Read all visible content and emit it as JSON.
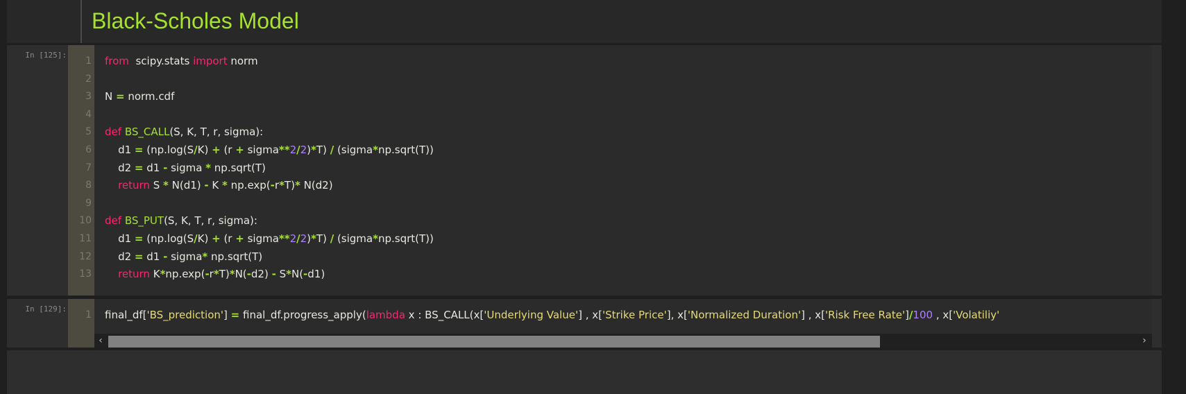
{
  "markdown": {
    "title": "Black-Scholes Model"
  },
  "cells": [
    {
      "prompt": "In [125]:",
      "lines": [
        {
          "n": "1",
          "tokens": [
            [
              "kw",
              "from"
            ],
            [
              "",
              "  scipy.stats "
            ],
            [
              "kw",
              "import"
            ],
            [
              "",
              " norm"
            ]
          ]
        },
        {
          "n": "2",
          "tokens": []
        },
        {
          "n": "3",
          "tokens": [
            [
              "",
              "N "
            ],
            [
              "op",
              "="
            ],
            [
              "",
              " norm.cdf"
            ]
          ]
        },
        {
          "n": "4",
          "tokens": []
        },
        {
          "n": "5",
          "tokens": [
            [
              "kw",
              "def"
            ],
            [
              "",
              " "
            ],
            [
              "fn",
              "BS_CALL"
            ],
            [
              "",
              "(S, K, T, r, sigma):"
            ]
          ]
        },
        {
          "n": "6",
          "tokens": [
            [
              "",
              "    d1 "
            ],
            [
              "op",
              "="
            ],
            [
              "",
              " (np.log(S"
            ],
            [
              "op",
              "/"
            ],
            [
              "",
              "K) "
            ],
            [
              "op",
              "+"
            ],
            [
              "",
              " (r "
            ],
            [
              "op",
              "+"
            ],
            [
              "",
              " sigma"
            ],
            [
              "op",
              "**"
            ],
            [
              "num",
              "2"
            ],
            [
              "op",
              "/"
            ],
            [
              "num",
              "2"
            ],
            [
              "",
              ")"
            ],
            [
              "op",
              "*"
            ],
            [
              "",
              "T) "
            ],
            [
              "op",
              "/"
            ],
            [
              "",
              " (sigma"
            ],
            [
              "op",
              "*"
            ],
            [
              "",
              "np.sqrt(T))"
            ]
          ]
        },
        {
          "n": "7",
          "tokens": [
            [
              "",
              "    d2 "
            ],
            [
              "op",
              "="
            ],
            [
              "",
              " d1 "
            ],
            [
              "op",
              "-"
            ],
            [
              "",
              " sigma "
            ],
            [
              "op",
              "*"
            ],
            [
              "",
              " np.sqrt(T)"
            ]
          ]
        },
        {
          "n": "8",
          "tokens": [
            [
              "",
              "    "
            ],
            [
              "kw",
              "return"
            ],
            [
              "",
              " S "
            ],
            [
              "op",
              "*"
            ],
            [
              "",
              " N(d1) "
            ],
            [
              "op",
              "-"
            ],
            [
              "",
              " K "
            ],
            [
              "op",
              "*"
            ],
            [
              "",
              " np.exp("
            ],
            [
              "op",
              "-"
            ],
            [
              "",
              "r"
            ],
            [
              "op",
              "*"
            ],
            [
              "",
              "T)"
            ],
            [
              "op",
              "*"
            ],
            [
              "",
              " N(d2)"
            ]
          ]
        },
        {
          "n": "9",
          "tokens": []
        },
        {
          "n": "10",
          "tokens": [
            [
              "kw",
              "def"
            ],
            [
              "",
              " "
            ],
            [
              "fn",
              "BS_PUT"
            ],
            [
              "",
              "(S, K, T, r, sigma):"
            ]
          ]
        },
        {
          "n": "11",
          "tokens": [
            [
              "",
              "    d1 "
            ],
            [
              "op",
              "="
            ],
            [
              "",
              " (np.log(S"
            ],
            [
              "op",
              "/"
            ],
            [
              "",
              "K) "
            ],
            [
              "op",
              "+"
            ],
            [
              "",
              " (r "
            ],
            [
              "op",
              "+"
            ],
            [
              "",
              " sigma"
            ],
            [
              "op",
              "**"
            ],
            [
              "num",
              "2"
            ],
            [
              "op",
              "/"
            ],
            [
              "num",
              "2"
            ],
            [
              "",
              ")"
            ],
            [
              "op",
              "*"
            ],
            [
              "",
              "T) "
            ],
            [
              "op",
              "/"
            ],
            [
              "",
              " (sigma"
            ],
            [
              "op",
              "*"
            ],
            [
              "",
              "np.sqrt(T))"
            ]
          ]
        },
        {
          "n": "12",
          "tokens": [
            [
              "",
              "    d2 "
            ],
            [
              "op",
              "="
            ],
            [
              "",
              " d1 "
            ],
            [
              "op",
              "-"
            ],
            [
              "",
              " sigma"
            ],
            [
              "op",
              "*"
            ],
            [
              "",
              " np.sqrt(T)"
            ]
          ]
        },
        {
          "n": "13",
          "tokens": [
            [
              "",
              "    "
            ],
            [
              "kw",
              "return"
            ],
            [
              "",
              " K"
            ],
            [
              "op",
              "*"
            ],
            [
              "",
              "np.exp("
            ],
            [
              "op",
              "-"
            ],
            [
              "",
              "r"
            ],
            [
              "op",
              "*"
            ],
            [
              "",
              "T)"
            ],
            [
              "op",
              "*"
            ],
            [
              "",
              "N("
            ],
            [
              "op",
              "-"
            ],
            [
              "",
              "d2) "
            ],
            [
              "op",
              "-"
            ],
            [
              "",
              " S"
            ],
            [
              "op",
              "*"
            ],
            [
              "",
              "N("
            ],
            [
              "op",
              "-"
            ],
            [
              "",
              "d1)"
            ]
          ]
        }
      ]
    },
    {
      "prompt": "In [129]:",
      "lines": [
        {
          "n": "1",
          "tokens": [
            [
              "",
              "final_df["
            ],
            [
              "str",
              "'BS_prediction'"
            ],
            [
              "",
              "] "
            ],
            [
              "op",
              "="
            ],
            [
              "",
              " final_df.progress_apply("
            ],
            [
              "kw",
              "lambda"
            ],
            [
              "",
              " x : BS_CALL(x["
            ],
            [
              "str",
              "'Underlying Value'"
            ],
            [
              "",
              "] , x["
            ],
            [
              "str",
              "'Strike Price'"
            ],
            [
              "",
              "], x["
            ],
            [
              "str",
              "'Normalized Duration'"
            ],
            [
              "",
              "] , x["
            ],
            [
              "str",
              "'Risk Free Rate'"
            ],
            [
              "",
              "]"
            ],
            [
              "op",
              "/"
            ],
            [
              "num",
              "100"
            ],
            [
              "",
              " , x["
            ],
            [
              "str",
              "'Volatiliy'"
            ]
          ]
        }
      ]
    }
  ],
  "scrollbar": {
    "left_arrow": "‹",
    "right_arrow": "›",
    "position_fraction": 0
  },
  "colors": {
    "keyword": "#f92672",
    "function": "#a6e22e",
    "number": "#ae81ff",
    "string": "#e6db74",
    "heading": "#a6e22e"
  }
}
